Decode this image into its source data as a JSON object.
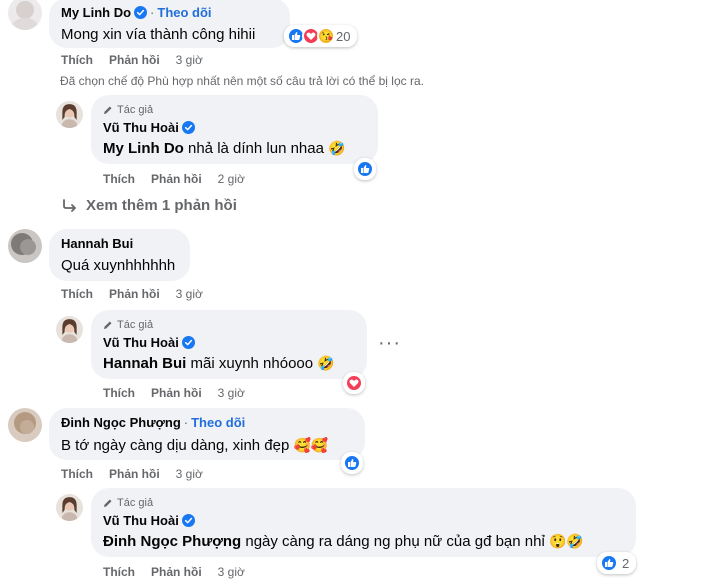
{
  "c1": {
    "name": "My Linh Do",
    "dot": "·",
    "follow": "Theo dõi",
    "text": "Mong xin vía thành công hihii",
    "reaction_count": "20",
    "like": "Thích",
    "reply": "Phản hồi",
    "time": "3 giờ"
  },
  "filter_note": "Đã chọn chế độ Phù hợp nhất nên một số câu trả lời có thể bị lọc ra.",
  "r1": {
    "author_tag": "Tác giả",
    "name": "Vũ Thu Hoài",
    "mention": "My Linh Do",
    "text": " nhả là dính lun nhaa ",
    "emoji": "🤣",
    "like": "Thích",
    "reply": "Phản hồi",
    "time": "2 giờ"
  },
  "more_replies": "Xem thêm 1 phản hồi",
  "c2": {
    "name": "Hannah Bui",
    "text": "Quá xuynhhhhhh",
    "like": "Thích",
    "reply": "Phản hồi",
    "time": "3 giờ"
  },
  "r2": {
    "author_tag": "Tác giả",
    "name": "Vũ Thu Hoài",
    "mention": "Hannah Bui",
    "text": " mãi xuynh nhóooo ",
    "emoji": "🤣",
    "like": "Thích",
    "reply": "Phản hồi",
    "time": "3 giờ",
    "more": "···"
  },
  "c3": {
    "name": "Đinh Ngọc Phượng",
    "dot": "·",
    "follow": "Theo dõi",
    "text": "B tớ ngày càng dịu dàng, xinh đẹp ",
    "emoji": "🥰🥰",
    "like": "Thích",
    "reply": "Phản hồi",
    "time": "3 giờ"
  },
  "r3": {
    "author_tag": "Tác giả",
    "name": "Vũ Thu Hoài",
    "mention": "Đinh Ngọc Phượng",
    "text": " ngày càng ra dáng ng phụ nữ của gđ bạn nhỉ ",
    "emoji": "😲🤣",
    "reaction_count": "2",
    "like": "Thích",
    "reply": "Phản hồi",
    "time": "3 giờ"
  },
  "colors": {
    "like_blue": "#1877f2",
    "love_red": "#f33e58",
    "haha_yellow": "#f7b928",
    "verified_blue": "#1877f2",
    "link_blue": "#216fdb"
  },
  "icons": [
    "like-icon",
    "love-icon",
    "haha-icon",
    "verified-icon",
    "pencil-icon",
    "reply-arrow-icon",
    "more-dots-icon"
  ]
}
